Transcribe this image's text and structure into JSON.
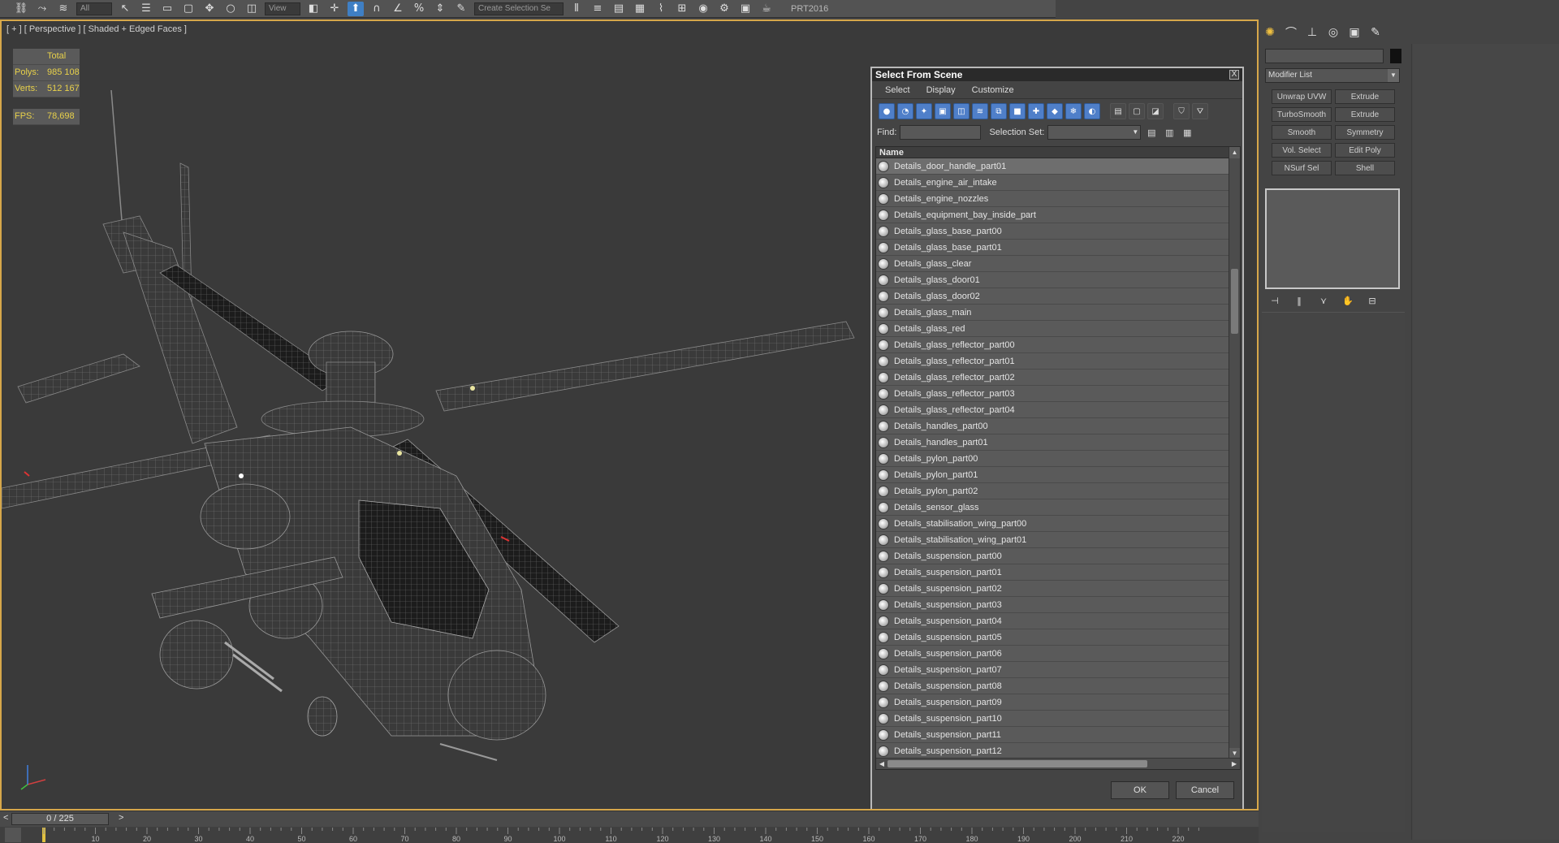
{
  "toolbar": {
    "selection_filter": "All",
    "view_dropdown": "View",
    "named_selection": "Create Selection Se",
    "workspace_label": "PRT2016"
  },
  "viewport": {
    "label": "[ + ] [ Perspective ] [ Shaded + Edged Faces ]",
    "stats_header": "Total",
    "polys_label": "Polys:",
    "polys_value": "985 108",
    "verts_label": "Verts:",
    "verts_value": "512 167",
    "fps_label": "FPS:",
    "fps_value": "78,698"
  },
  "dialog": {
    "title": "Select From Scene",
    "close_label": "X",
    "menu": [
      "Select",
      "Display",
      "Customize"
    ],
    "find_label": "Find:",
    "find_value": "",
    "selection_set_label": "Selection Set:",
    "column_name": "Name",
    "items": [
      "Details_door_handle_part01",
      "Details_engine_air_intake",
      "Details_engine_nozzles",
      "Details_equipment_bay_inside_part",
      "Details_glass_base_part00",
      "Details_glass_base_part01",
      "Details_glass_clear",
      "Details_glass_door01",
      "Details_glass_door02",
      "Details_glass_main",
      "Details_glass_red",
      "Details_glass_reflector_part00",
      "Details_glass_reflector_part01",
      "Details_glass_reflector_part02",
      "Details_glass_reflector_part03",
      "Details_glass_reflector_part04",
      "Details_handles_part00",
      "Details_handles_part01",
      "Details_pylon_part00",
      "Details_pylon_part01",
      "Details_pylon_part02",
      "Details_sensor_glass",
      "Details_stabilisation_wing_part00",
      "Details_stabilisation_wing_part01",
      "Details_suspension_part00",
      "Details_suspension_part01",
      "Details_suspension_part02",
      "Details_suspension_part03",
      "Details_suspension_part04",
      "Details_suspension_part05",
      "Details_suspension_part06",
      "Details_suspension_part07",
      "Details_suspension_part08",
      "Details_suspension_part09",
      "Details_suspension_part10",
      "Details_suspension_part11",
      "Details_suspension_part12"
    ],
    "ok_label": "OK",
    "cancel_label": "Cancel"
  },
  "command_panel": {
    "modifier_list_label": "Modifier List",
    "modifiers": [
      "Unwrap UVW",
      "Extrude",
      "TurboSmooth",
      "Extrude",
      "Smooth",
      "Symmetry",
      "Vol. Select",
      "Edit Poly",
      "NSurf Sel",
      "Shell"
    ]
  },
  "timeline": {
    "frame_readout": "0 / 225",
    "prev_label": "<",
    "next_label": ">",
    "ticks": [
      "10",
      "20",
      "30",
      "40",
      "50",
      "60",
      "70",
      "80",
      "90",
      "100",
      "110",
      "120",
      "130",
      "140",
      "150",
      "160",
      "170",
      "180",
      "190",
      "200",
      "210",
      "220"
    ]
  },
  "colors": {
    "viewport_border": "#d6a74a",
    "stats_text": "#e8d14a",
    "accent_button": "#4f7fc9"
  }
}
